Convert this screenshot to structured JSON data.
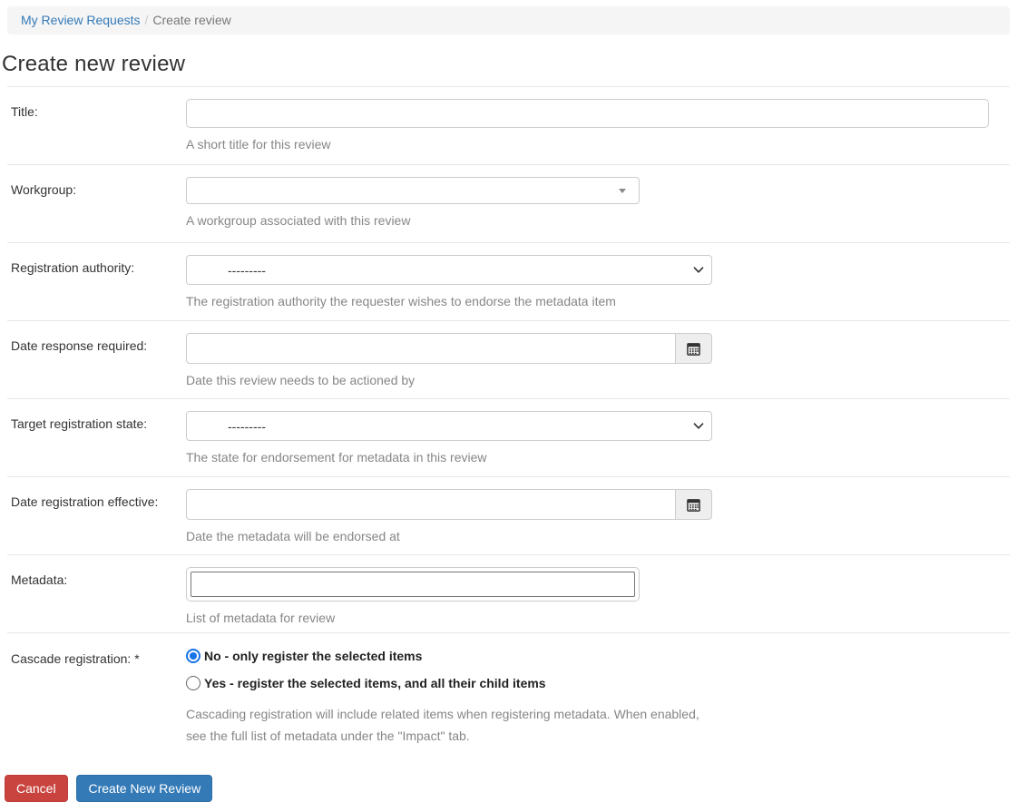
{
  "breadcrumb": {
    "items": [
      {
        "label": "My Review Requests",
        "type": "link"
      },
      {
        "label": "Create review",
        "type": "current"
      }
    ],
    "separator": "/"
  },
  "page": {
    "title": "Create new review"
  },
  "form": {
    "fields": [
      {
        "label": "Title:",
        "widget": "text",
        "value": "",
        "placeholder": "",
        "help": "A short title for this review"
      },
      {
        "label": "Workgroup:",
        "widget": "select2",
        "value": "",
        "help": "A workgroup associated with this review"
      },
      {
        "label": "Registration authority:",
        "widget": "select",
        "value": "---------",
        "help": "The registration authority the requester wishes to endorse the metadata item"
      },
      {
        "label": "Date response required:",
        "widget": "date",
        "value": "",
        "help": "Date this review needs to be actioned by"
      },
      {
        "label": "Target registration state:",
        "widget": "select",
        "value": "---------",
        "help": "The state for endorsement for metadata in this review"
      },
      {
        "label": "Date registration effective:",
        "widget": "date",
        "value": "",
        "help": "Date the metadata will be endorsed at"
      },
      {
        "label": "Metadata:",
        "widget": "multiselect",
        "value": "",
        "help": "List of metadata for review"
      },
      {
        "label": "Cascade registration:",
        "required_indicator": "*",
        "widget": "radio",
        "options": [
          {
            "label": "No - only register the selected items",
            "selected": true
          },
          {
            "label": "Yes - register the selected items, and all their child items",
            "selected": false
          }
        ],
        "help": "Cascading registration will include related items when registering metadata. When enabled, see the full list of metadata under the \"Impact\" tab."
      }
    ]
  },
  "actions": {
    "cancel_label": "Cancel",
    "submit_label": "Create New Review"
  },
  "colors": {
    "link": "#337ab7",
    "primary_button": "#337ab7",
    "danger_button": "#c9443f",
    "radio_accent": "#1673e8",
    "breadcrumb_background": "#f5f5f5",
    "help_text": "#868686",
    "divider": "#e7e7e7"
  }
}
